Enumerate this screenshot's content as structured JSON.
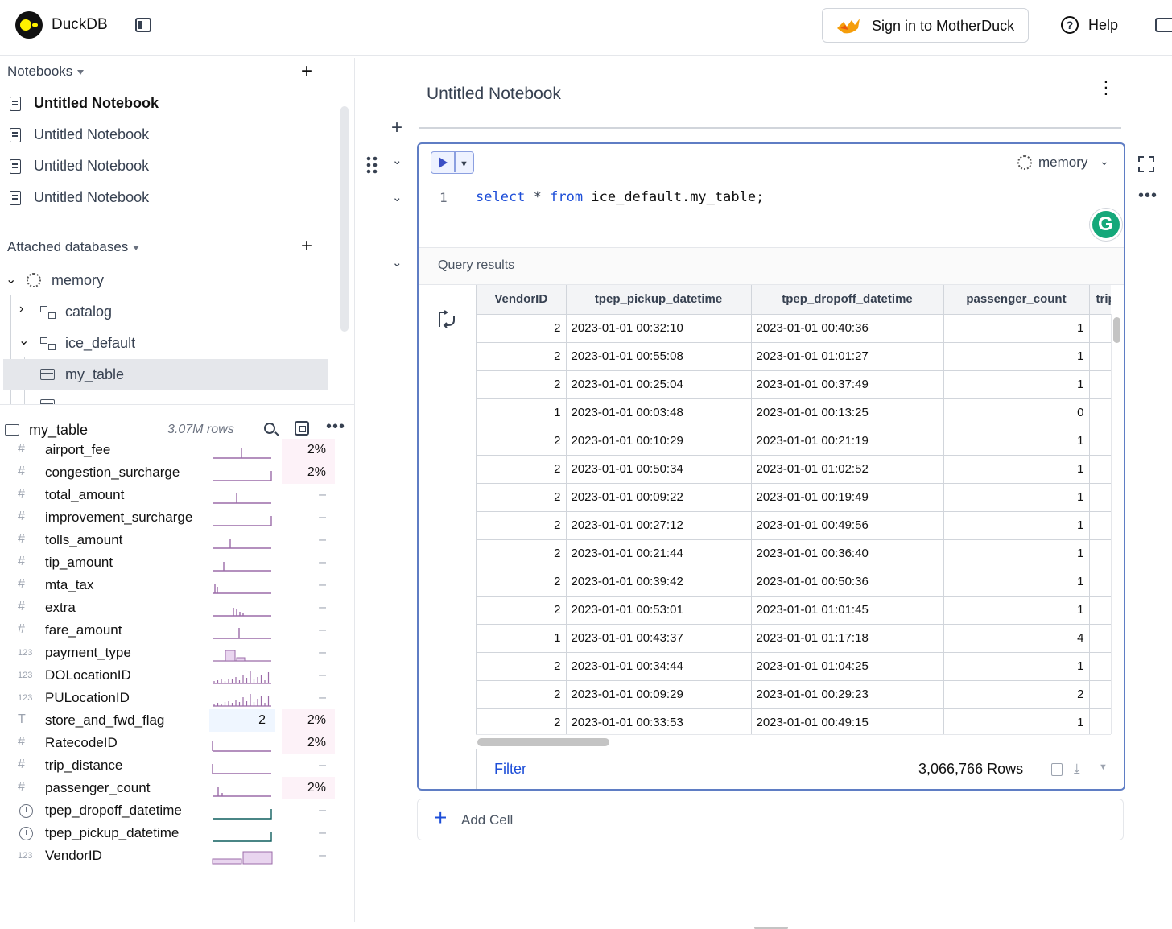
{
  "app": {
    "brand": "DuckDB"
  },
  "topbar": {
    "motherduck_label": "Sign in to MotherDuck",
    "help_label": "Help"
  },
  "sidebar": {
    "notebooks_header": "Notebooks",
    "notebooks": [
      "Untitled Notebook",
      "Untitled Notebook",
      "Untitled Notebook",
      "Untitled Notebook"
    ],
    "databases_header": "Attached databases",
    "tree": {
      "memory": "memory",
      "catalog": "catalog",
      "ice_default": "ice_default",
      "my_table": "my_table"
    }
  },
  "column_panel": {
    "table_name": "my_table",
    "row_count": "3.07M rows",
    "columns": [
      {
        "type": "#",
        "name": "airport_fee",
        "nulls": "2%"
      },
      {
        "type": "#",
        "name": "congestion_surcharge",
        "nulls": "2%"
      },
      {
        "type": "#",
        "name": "total_amount",
        "nulls": "–"
      },
      {
        "type": "#",
        "name": "improvement_surcharge",
        "nulls": "–"
      },
      {
        "type": "#",
        "name": "tolls_amount",
        "nulls": "–"
      },
      {
        "type": "#",
        "name": "tip_amount",
        "nulls": "–"
      },
      {
        "type": "#",
        "name": "mta_tax",
        "nulls": "–"
      },
      {
        "type": "#",
        "name": "extra",
        "nulls": "–"
      },
      {
        "type": "#",
        "name": "fare_amount",
        "nulls": "–"
      },
      {
        "type": "123",
        "name": "payment_type",
        "nulls": "–"
      },
      {
        "type": "123",
        "name": "DOLocationID",
        "nulls": "–"
      },
      {
        "type": "123",
        "name": "PULocationID",
        "nulls": "–"
      },
      {
        "type": "T",
        "name": "store_and_fwd_flag",
        "distinct": "2",
        "nulls": "2%"
      },
      {
        "type": "#",
        "name": "RatecodeID",
        "nulls": "2%"
      },
      {
        "type": "#",
        "name": "trip_distance",
        "nulls": "–"
      },
      {
        "type": "#",
        "name": "passenger_count",
        "nulls": "2%"
      },
      {
        "type": "clock",
        "name": "tpep_dropoff_datetime",
        "nulls": "–"
      },
      {
        "type": "clock",
        "name": "tpep_pickup_datetime",
        "nulls": "–"
      },
      {
        "type": "123",
        "name": "VendorID",
        "nulls": "–"
      }
    ]
  },
  "notebook": {
    "title": "Untitled Notebook",
    "cell": {
      "database": "memory",
      "line_number": "1",
      "code": {
        "kw1": "select",
        "star": "*",
        "kw2": "from",
        "rest": "ice_default.my_table;"
      }
    },
    "results": {
      "label": "Query results",
      "columns": [
        "VendorID",
        "tpep_pickup_datetime",
        "tpep_dropoff_datetime",
        "passenger_count",
        "trip"
      ],
      "rows": [
        [
          "2",
          "2023-01-01 00:32:10",
          "2023-01-01 00:40:36",
          "1"
        ],
        [
          "2",
          "2023-01-01 00:55:08",
          "2023-01-01 01:01:27",
          "1"
        ],
        [
          "2",
          "2023-01-01 00:25:04",
          "2023-01-01 00:37:49",
          "1"
        ],
        [
          "1",
          "2023-01-01 00:03:48",
          "2023-01-01 00:13:25",
          "0"
        ],
        [
          "2",
          "2023-01-01 00:10:29",
          "2023-01-01 00:21:19",
          "1"
        ],
        [
          "2",
          "2023-01-01 00:50:34",
          "2023-01-01 01:02:52",
          "1"
        ],
        [
          "2",
          "2023-01-01 00:09:22",
          "2023-01-01 00:19:49",
          "1"
        ],
        [
          "2",
          "2023-01-01 00:27:12",
          "2023-01-01 00:49:56",
          "1"
        ],
        [
          "2",
          "2023-01-01 00:21:44",
          "2023-01-01 00:36:40",
          "1"
        ],
        [
          "2",
          "2023-01-01 00:39:42",
          "2023-01-01 00:50:36",
          "1"
        ],
        [
          "2",
          "2023-01-01 00:53:01",
          "2023-01-01 01:01:45",
          "1"
        ],
        [
          "1",
          "2023-01-01 00:43:37",
          "2023-01-01 01:17:18",
          "4"
        ],
        [
          "2",
          "2023-01-01 00:34:44",
          "2023-01-01 01:04:25",
          "1"
        ],
        [
          "2",
          "2023-01-01 00:09:29",
          "2023-01-01 00:29:23",
          "2"
        ],
        [
          "2",
          "2023-01-01 00:33:53",
          "2023-01-01 00:49:15",
          "1"
        ]
      ],
      "filter_label": "Filter",
      "row_count": "3,066,766 Rows"
    },
    "add_cell_label": "Add Cell"
  },
  "colors": {
    "accent": "#1d4ed8",
    "cell_border": "#5f7dc4",
    "spark": "#9b6ba8",
    "null_highlight": "#fdf2f8"
  },
  "icons": [
    "duckdb-logo-icon",
    "sidebar-toggle-icon",
    "duck-icon",
    "help-icon",
    "panel-toggle-icon",
    "notebook-icon",
    "plus-icon",
    "memory-db-icon",
    "schema-icon",
    "table-icon",
    "search-icon",
    "focus-icon",
    "more-icon",
    "play-icon",
    "expand-icon",
    "drag-handle-icon",
    "copy-icon",
    "download-icon"
  ]
}
